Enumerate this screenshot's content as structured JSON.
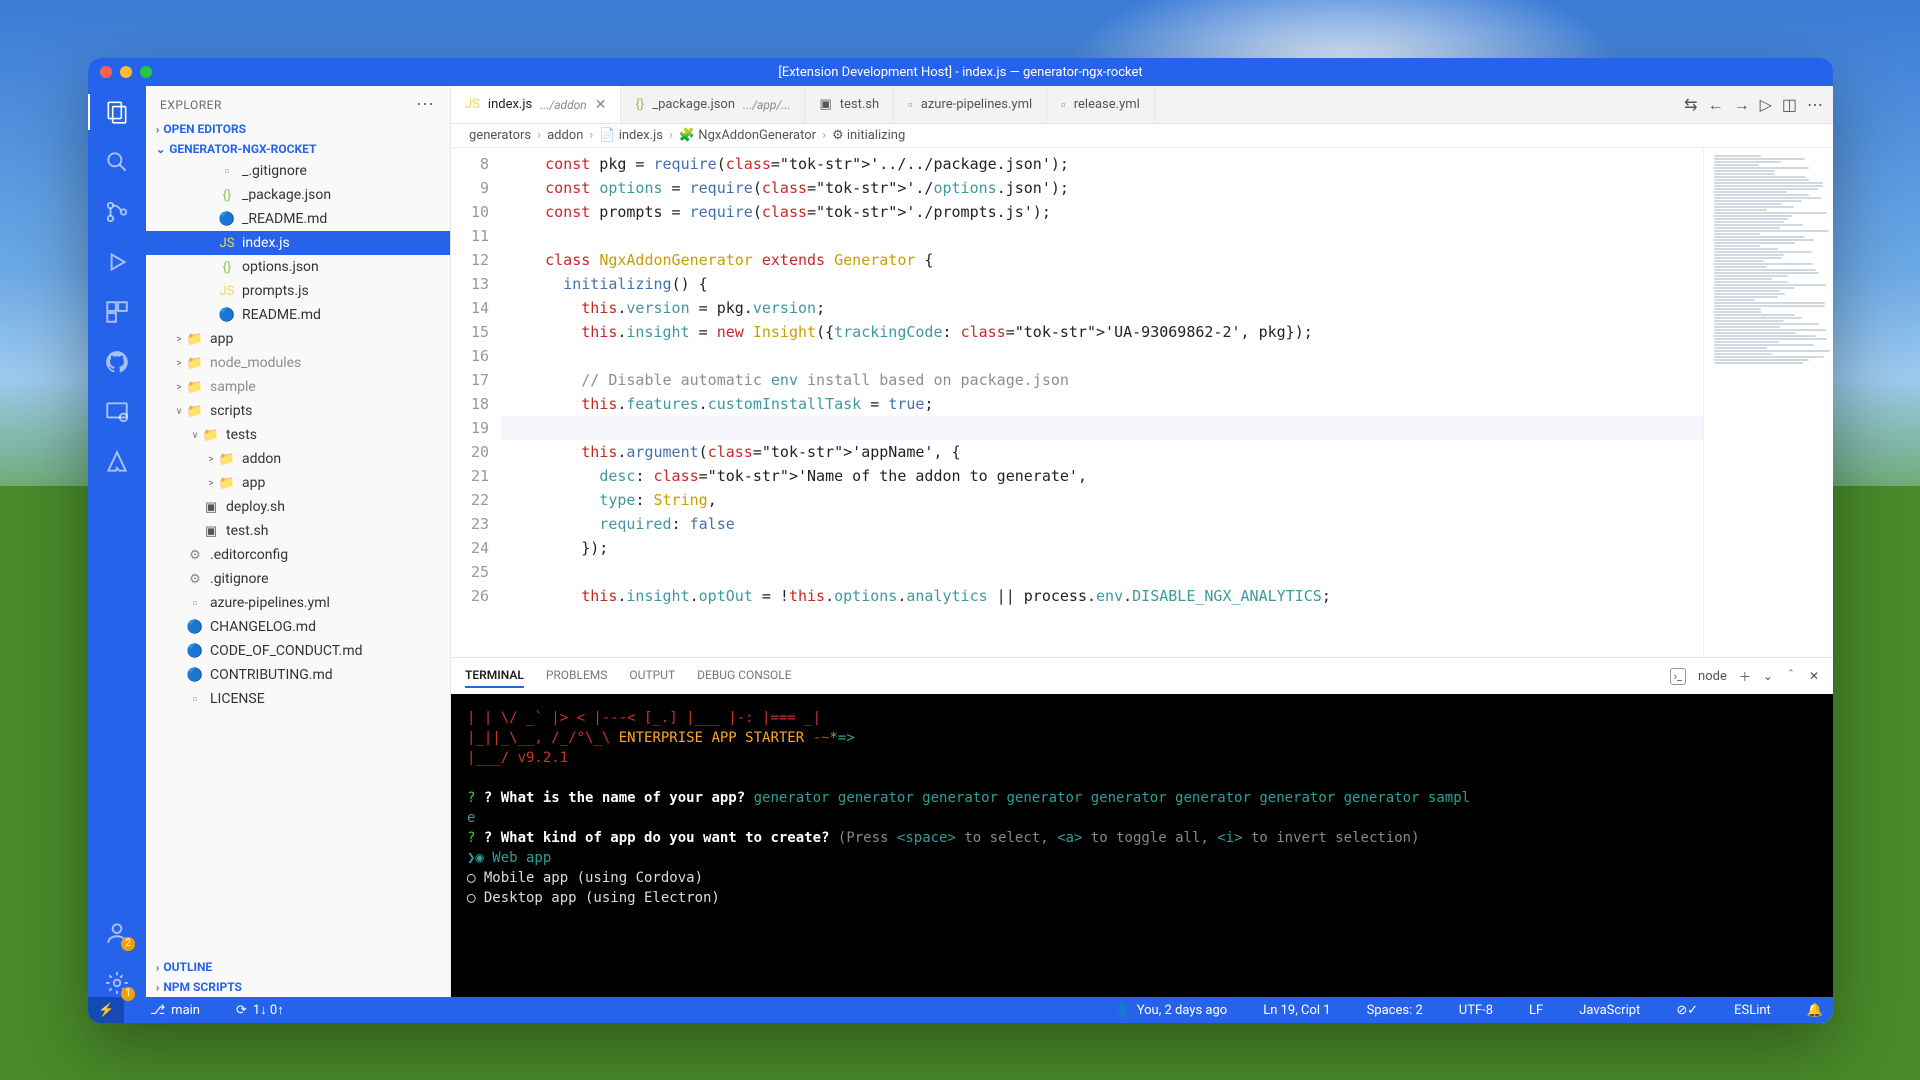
{
  "window_title": "[Extension Development Host] - index.js — generator-ngx-rocket",
  "explorer": {
    "title": "EXPLORER",
    "sections": {
      "open_editors": "OPEN EDITORS",
      "project": "GENERATOR-NGX-ROCKET",
      "outline": "OUTLINE",
      "npm_scripts": "NPM SCRIPTS"
    },
    "tree": [
      {
        "depth": 3,
        "icon": "file",
        "name": "_.gitignore"
      },
      {
        "depth": 3,
        "icon": "json",
        "name": "_package.json"
      },
      {
        "depth": 3,
        "icon": "md",
        "name": "_README.md"
      },
      {
        "depth": 3,
        "icon": "js",
        "name": "index.js",
        "selected": true
      },
      {
        "depth": 3,
        "icon": "json",
        "name": "options.json"
      },
      {
        "depth": 3,
        "icon": "js",
        "name": "prompts.js"
      },
      {
        "depth": 3,
        "icon": "md",
        "name": "README.md"
      },
      {
        "depth": 1,
        "icon": "folder",
        "name": "app",
        "chev": ">"
      },
      {
        "depth": 1,
        "icon": "folder-dim",
        "name": "node_modules",
        "chev": ">"
      },
      {
        "depth": 1,
        "icon": "folder-dim",
        "name": "sample",
        "chev": ">"
      },
      {
        "depth": 1,
        "icon": "folder",
        "name": "scripts",
        "chev": "v"
      },
      {
        "depth": 2,
        "icon": "folder",
        "name": "tests",
        "chev": "v"
      },
      {
        "depth": 3,
        "icon": "folder",
        "name": "addon",
        "chev": ">"
      },
      {
        "depth": 3,
        "icon": "folder",
        "name": "app",
        "chev": ">"
      },
      {
        "depth": 2,
        "icon": "sh",
        "name": "deploy.sh"
      },
      {
        "depth": 2,
        "icon": "sh",
        "name": "test.sh"
      },
      {
        "depth": 1,
        "icon": "gear",
        "name": ".editorconfig"
      },
      {
        "depth": 1,
        "icon": "gear",
        "name": ".gitignore"
      },
      {
        "depth": 1,
        "icon": "file",
        "name": "azure-pipelines.yml"
      },
      {
        "depth": 1,
        "icon": "md",
        "name": "CHANGELOG.md"
      },
      {
        "depth": 1,
        "icon": "md",
        "name": "CODE_OF_CONDUCT.md"
      },
      {
        "depth": 1,
        "icon": "md",
        "name": "CONTRIBUTING.md"
      },
      {
        "depth": 1,
        "icon": "file",
        "name": "LICENSE"
      }
    ]
  },
  "activity_badges": {
    "accounts": "2",
    "settings": "1"
  },
  "tabs": [
    {
      "icon": "js",
      "label": "index.js",
      "path": ".../addon",
      "active": true,
      "close": true
    },
    {
      "icon": "json",
      "label": "_package.json",
      "path": ".../app/..."
    },
    {
      "icon": "sh",
      "label": "test.sh"
    },
    {
      "icon": "file",
      "label": "azure-pipelines.yml"
    },
    {
      "icon": "file",
      "label": "release.yml"
    }
  ],
  "breadcrumb": [
    "generators",
    "addon",
    "index.js",
    "NgxAddonGenerator",
    "initializing"
  ],
  "code": {
    "first_line": 8,
    "current_line": 19,
    "lines": [
      "const pkg = require('../../package.json');",
      "const options = require('./options.json');",
      "const prompts = require('./prompts.js');",
      "",
      "class NgxAddonGenerator extends Generator {",
      "  initializing() {",
      "    this.version = pkg.version;",
      "    this.insight = new Insight({trackingCode: 'UA-93069862-2', pkg});",
      "",
      "    // Disable automatic env install based on package.json",
      "    this.features.customInstallTask = true;",
      "",
      "    this.argument('appName', {",
      "      desc: 'Name of the addon to generate',",
      "      type: String,",
      "      required: false",
      "    });",
      "",
      "    this.insight.optOut = !this.options.analytics || process.env.DISABLE_NGX_ANALYTICS;"
    ]
  },
  "panel": {
    "tabs": [
      "TERMINAL",
      "PROBLEMS",
      "OUTPUT",
      "DEBUG CONSOLE"
    ],
    "active": "TERMINAL",
    "shell": "node",
    "terminal": {
      "ascii1": "| | \\/ _` |>   < |---< [_.] |___ |-:  |=== _|",
      "ascii2": "|_||_\\__, /_/°\\_\\ ENTERPRISE APP STARTER -~*=>",
      "ascii3": "     |___/ v9.2.1",
      "q1": "? What is the name of your app?",
      "a1": "generator generator generator generator generator generator generator generator sampl",
      "a1b": "e",
      "q2": "? What kind of app do you want to create?",
      "hint": "(Press <space> to select, <a> to toggle all, <i> to invert selection)",
      "opt1": "❯◉ Web app",
      "opt2": "◯ Mobile app (using Cordova)",
      "opt3": "◯ Desktop app (using Electron)"
    }
  },
  "status": {
    "branch": "main",
    "sync": "1↓ 0↑",
    "blame": "You, 2 days ago",
    "position": "Ln 19, Col 1",
    "spaces": "Spaces: 2",
    "encoding": "UTF-8",
    "eol": "LF",
    "lang": "JavaScript",
    "lint": "ESLint"
  }
}
